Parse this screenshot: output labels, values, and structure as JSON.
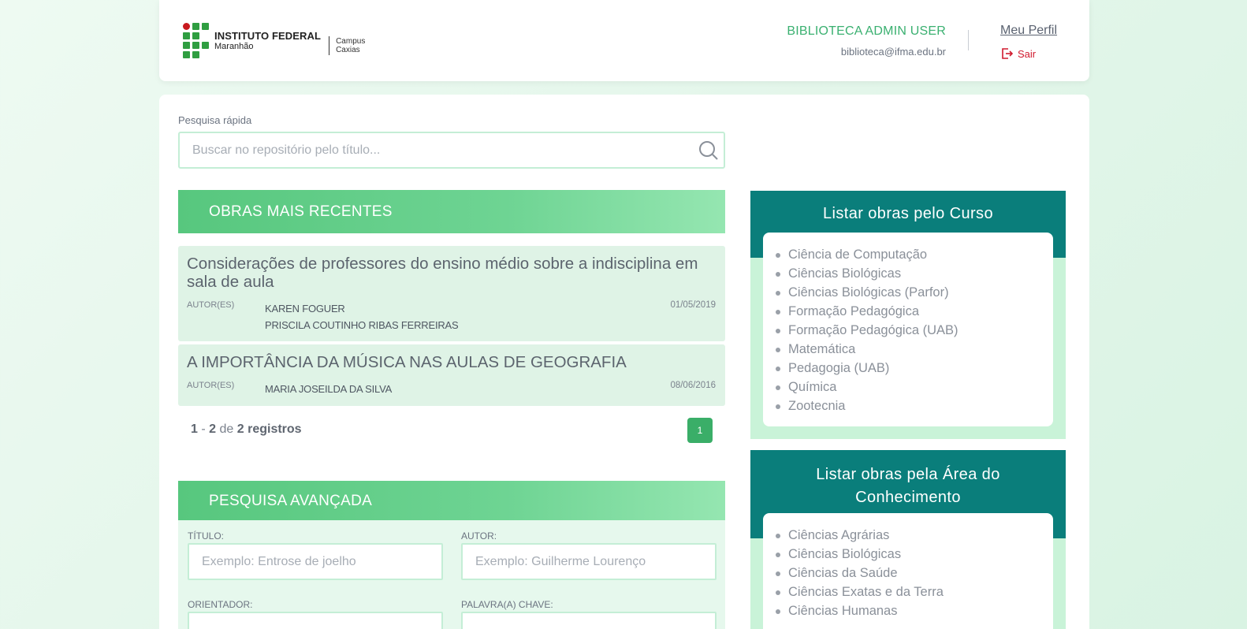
{
  "header": {
    "logo": {
      "line1": "INSTITUTO FEDERAL",
      "line2": "Maranhão",
      "campus_line1": "Campus",
      "campus_line2": "Caxias"
    },
    "user_name": "BIBLIOTECA ADMIN USER",
    "user_email": "biblioteca@ifma.edu.br",
    "profile_link": "Meu Perfil",
    "logout_label": "Sair"
  },
  "quick_search": {
    "label": "Pesquisa rápida",
    "placeholder": "Buscar no repositório pelo título..."
  },
  "recent": {
    "title": "OBRAS MAIS RECENTES",
    "author_label": "AUTOR(ES)",
    "works": [
      {
        "title": "Considerações de professores do ensino médio sobre a indisciplina em sala de aula",
        "authors": [
          "KAREN FOGUER",
          "PRISCILA COUTINHO RIBAS FERREIRAS"
        ],
        "date": "01/05/2019"
      },
      {
        "title": "A IMPORTÂNCIA DA MÚSICA NAS AULAS DE GEOGRAFIA",
        "authors": [
          "MARIA JOSEILDA DA SILVA"
        ],
        "date": "08/06/2016"
      }
    ],
    "pager": {
      "from": "1",
      "dash": "-",
      "to": "2",
      "of": "de",
      "total": "2 registros",
      "current_page": "1"
    }
  },
  "advanced": {
    "title": "PESQUISA AVANÇADA",
    "title_label": "TÍTULO:",
    "title_placeholder": "Exemplo: Entrose de joelho",
    "author_label": "AUTOR:",
    "author_placeholder": "Exemplo: Guilherme Lourenço",
    "advisor_label": "ORIENTADOR:",
    "keyword_label": "PALAVRA(A) CHAVE:"
  },
  "by_course": {
    "title": "Listar obras pelo Curso",
    "items": [
      "Ciência de Computação",
      "Ciências Biológicas",
      "Ciências Biológicas (Parfor)",
      "Formação Pedagógica",
      "Formação Pedagógica (UAB)",
      "Matemática",
      "Pedagogia (UAB)",
      "Química",
      "Zootecnia"
    ]
  },
  "by_area": {
    "title_line1": "Listar obras pela Área do",
    "title_line2": "Conhecimento",
    "items": [
      "Ciências Agrárias",
      "Ciências Biológicas",
      "Ciências da Saúde",
      "Ciências Exatas e da Terra",
      "Ciências Humanas"
    ]
  },
  "colors": {
    "brand_green": "#3ab070",
    "teal": "#0a7e7b",
    "logout_red": "#d01a2e"
  }
}
